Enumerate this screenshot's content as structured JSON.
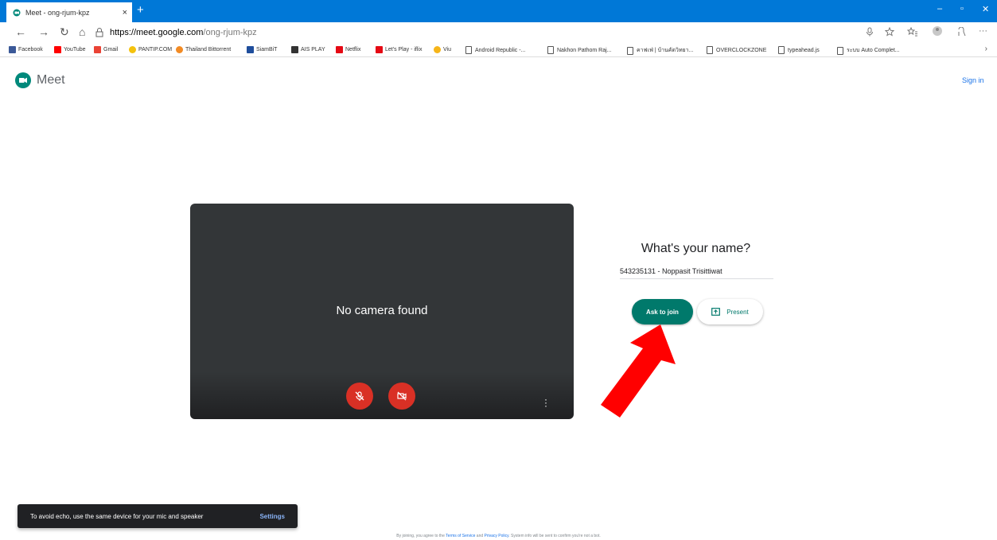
{
  "browser": {
    "tab_title": "Meet - ong-rjum-kpz",
    "tab_close": "×",
    "new_tab": "+",
    "url_domain": "https://meet.google.com",
    "url_path": "/ong-rjum-kpz",
    "win_minimize": "–",
    "win_restore": "▫",
    "win_close": "✕",
    "nav_back": "←",
    "nav_forward": "→",
    "nav_refresh": "↻",
    "nav_home": "⌂"
  },
  "bookmarks": [
    {
      "label": "Facebook",
      "color": "#3b5998"
    },
    {
      "label": "YouTube",
      "color": "#ff0000"
    },
    {
      "label": "Gmail",
      "color": "#ea4335"
    },
    {
      "label": "PANTIP.COM",
      "color": "#f4c20d"
    },
    {
      "label": "Thailand Bittorrent",
      "color": "#f28b24"
    },
    {
      "label": "SiamBiT",
      "color": "#1f4e9c"
    },
    {
      "label": "AIS PLAY",
      "color": "#333333"
    },
    {
      "label": "Netflix",
      "color": "#e50914"
    },
    {
      "label": "Let's Play - iflix",
      "color": "#e50914"
    },
    {
      "label": "Viu",
      "color": "#f6b519"
    },
    {
      "label": "Android Republic -...",
      "color": ""
    },
    {
      "label": "Nakhon Pathom Raj...",
      "color": ""
    },
    {
      "label": "คาฟเฟ่ | บ้านคัดวิทยา...",
      "color": ""
    },
    {
      "label": "OVERCLOCKZONE",
      "color": ""
    },
    {
      "label": "typeahead.js",
      "color": ""
    },
    {
      "label": "ระบบ Auto Complet...",
      "color": ""
    }
  ],
  "header": {
    "logo_text": "Meet",
    "sign_in": "Sign in"
  },
  "video": {
    "no_camera": "No camera found"
  },
  "join": {
    "heading": "What's your name?",
    "name_value": "543235131 - Noppasit Trisittiwat",
    "ask_label": "Ask to join",
    "present_label": "Present"
  },
  "toast": {
    "message": "To avoid echo, use the same device for your mic and speaker",
    "action": "Settings"
  },
  "footer": {
    "prefix": "By joining, you agree to the",
    "terms": "Terms of Service",
    "and": "and",
    "privacy": "Privacy Policy",
    "suffix": ". System info will be sent to confirm you're not a bot."
  },
  "colors": {
    "accent": "#00796b",
    "danger": "#d93025",
    "tabbar": "#0078d7",
    "annotation_arrow": "#ff0000"
  }
}
